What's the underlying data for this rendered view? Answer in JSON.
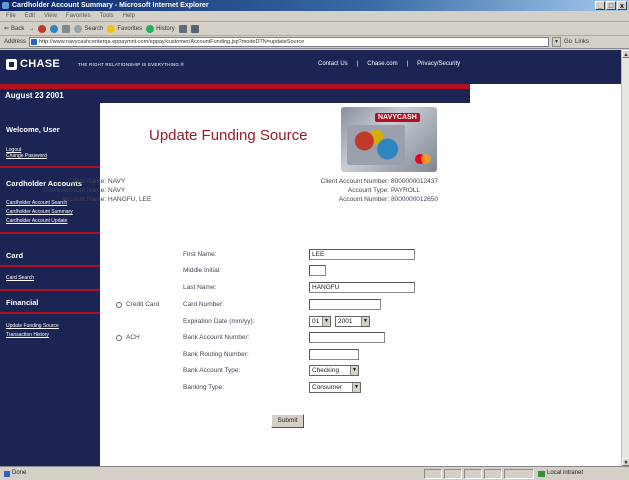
{
  "window": {
    "title": "Cardholder Account Summary - Microsoft Internet Explorer",
    "controls": [
      "_",
      "□",
      "x"
    ]
  },
  "menu": [
    "File",
    "Edit",
    "View",
    "Favorites",
    "Tools",
    "Help"
  ],
  "toolbar": {
    "back": "Back",
    "search": "Search",
    "favorites": "Favorites",
    "history": "History"
  },
  "address": {
    "label": "Address",
    "url": "http://www.navycashcenterqa.eppaymnt.com/eppay/customer/AccountFunding.jsp?modeDTN=updateSource",
    "go": "Go",
    "links": "Links"
  },
  "header": {
    "logo": "CHASE",
    "tagline": "THE RIGHT RELATIONSHIP IS EVERYTHING.®",
    "links": [
      "Contact Us",
      "|",
      "Chase.com",
      "|",
      "Privacy/Security"
    ],
    "date": "August 23 2001"
  },
  "sidebar": {
    "welcome": "Welcome, User",
    "account_links": [
      "Logout",
      "Change Password"
    ],
    "sections": [
      {
        "title": "Cardholder Accounts",
        "links": [
          "Cardholder Account Search",
          "Cardholder Account Summary",
          "Cardholder Account Update"
        ]
      },
      {
        "title": "Card",
        "links": [
          "Card Search"
        ]
      },
      {
        "title": "Financial",
        "links": [
          "Update Funding Source",
          "Transaction History"
        ]
      }
    ]
  },
  "main": {
    "title": "Update Funding Source",
    "card_brand": "NAVYCASH"
  },
  "client": {
    "left": [
      {
        "label": "Client Name:",
        "value": "NAVY"
      },
      {
        "label": "Client Account Name:",
        "value": "NAVY"
      },
      {
        "label": "Account Name:",
        "value": "HANGFU, LEE"
      }
    ],
    "right": [
      {
        "label": "Client Account Number:",
        "value": "8000000012437"
      },
      {
        "label": "Account Type:",
        "value": "PAYROLL"
      },
      {
        "label": "Account Number:",
        "value": "8000000012650"
      }
    ]
  },
  "form": {
    "first_name": {
      "label": "First Name:",
      "value": "LEE"
    },
    "middle_initial": {
      "label": "Middle Initial:",
      "value": ""
    },
    "last_name": {
      "label": "Last Name:",
      "value": "HANGFU"
    },
    "credit_card_option": "Credit Card",
    "card_number": {
      "label": "Card Number:",
      "value": ""
    },
    "expiration": {
      "label": "Expiration Date (mm/yy):",
      "month": "01",
      "year": "2001"
    },
    "ach_option": "ACH",
    "bank_account_number": {
      "label": "Bank Account Number:",
      "value": ""
    },
    "bank_routing_number": {
      "label": "Bank Routing Number:",
      "value": ""
    },
    "bank_account_type": {
      "label": "Bank Account Type:",
      "value": "Checking"
    },
    "banking_type": {
      "label": "Banking Type:",
      "value": "Consumer"
    },
    "submit": "Submit"
  },
  "status": {
    "left": "Done",
    "zone": "Local intranet"
  }
}
